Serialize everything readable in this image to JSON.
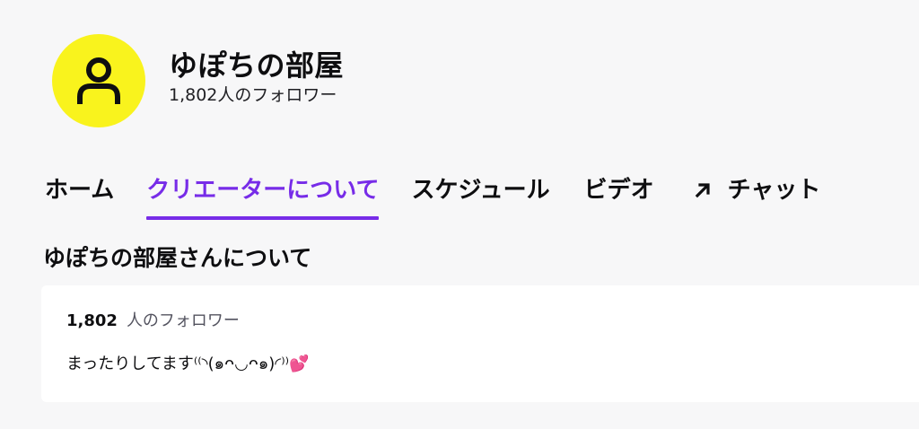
{
  "channel": {
    "name": "ゆぽちの部屋",
    "follower_line": "1,802人のフォロワー",
    "avatar_color": "#f9f31d"
  },
  "tabs": [
    {
      "label": "ホーム",
      "active": false
    },
    {
      "label": "クリエーターについて",
      "active": true
    },
    {
      "label": "スケジュール",
      "active": false
    },
    {
      "label": "ビデオ",
      "active": false
    },
    {
      "label": "チャット",
      "active": false,
      "icon": "external-arrow-icon"
    }
  ],
  "accent_color": "#772ce8",
  "about": {
    "heading": "ゆぽちの部屋さんについて",
    "follower_count": "1,802",
    "follower_label": "人のフォロワー",
    "bio": "まったりしてます⁽⁽◝(๑ᴖ◡ᴖ๑)◜⁾⁾💕"
  }
}
